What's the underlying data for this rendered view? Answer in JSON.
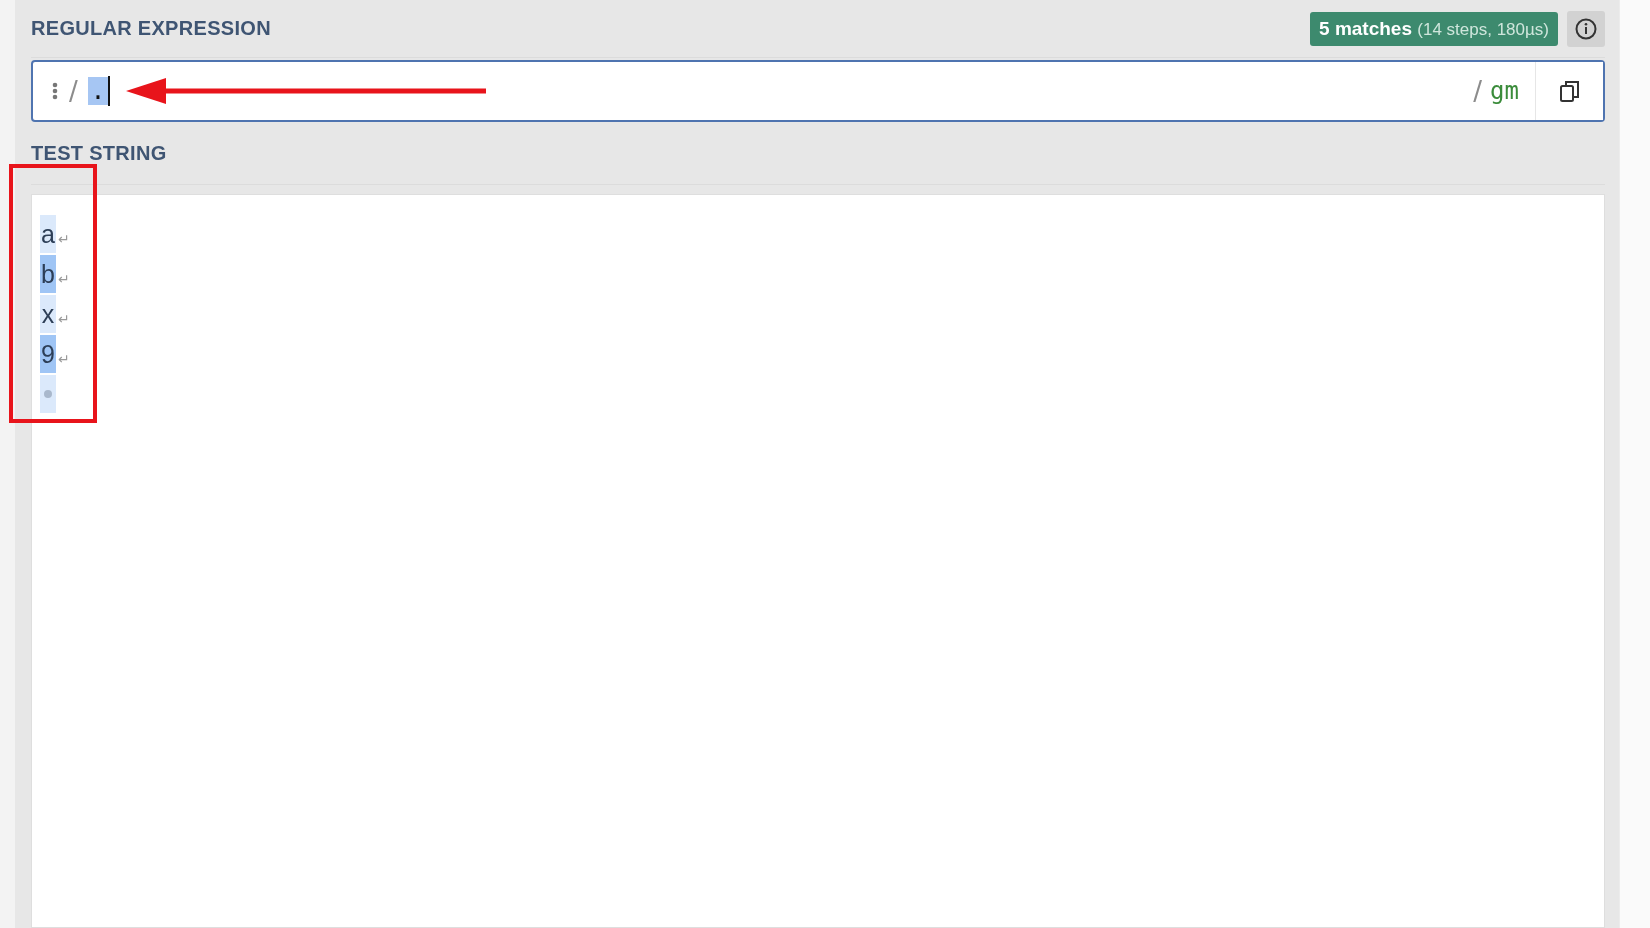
{
  "regex_section": {
    "heading": "REGULAR EXPRESSION",
    "match_badge": {
      "count": "5 matches",
      "details": "(14 steps, 180µs)"
    },
    "regex_field": {
      "open_delimiter": "/",
      "pattern": ".",
      "pattern_selected": true,
      "close_delimiter": "/",
      "flags": "gm"
    }
  },
  "test_section": {
    "heading": "TEST STRING",
    "lines": [
      {
        "kind": "char",
        "text": "a",
        "strong": false,
        "end_mark": "↵"
      },
      {
        "kind": "char",
        "text": "b",
        "strong": true,
        "end_mark": "↵"
      },
      {
        "kind": "char",
        "text": "x",
        "strong": false,
        "end_mark": "↵"
      },
      {
        "kind": "char",
        "text": "9",
        "strong": true,
        "end_mark": "↵"
      },
      {
        "kind": "empty",
        "strong": false
      }
    ]
  },
  "annotations": {
    "arrow": true,
    "box": true
  }
}
